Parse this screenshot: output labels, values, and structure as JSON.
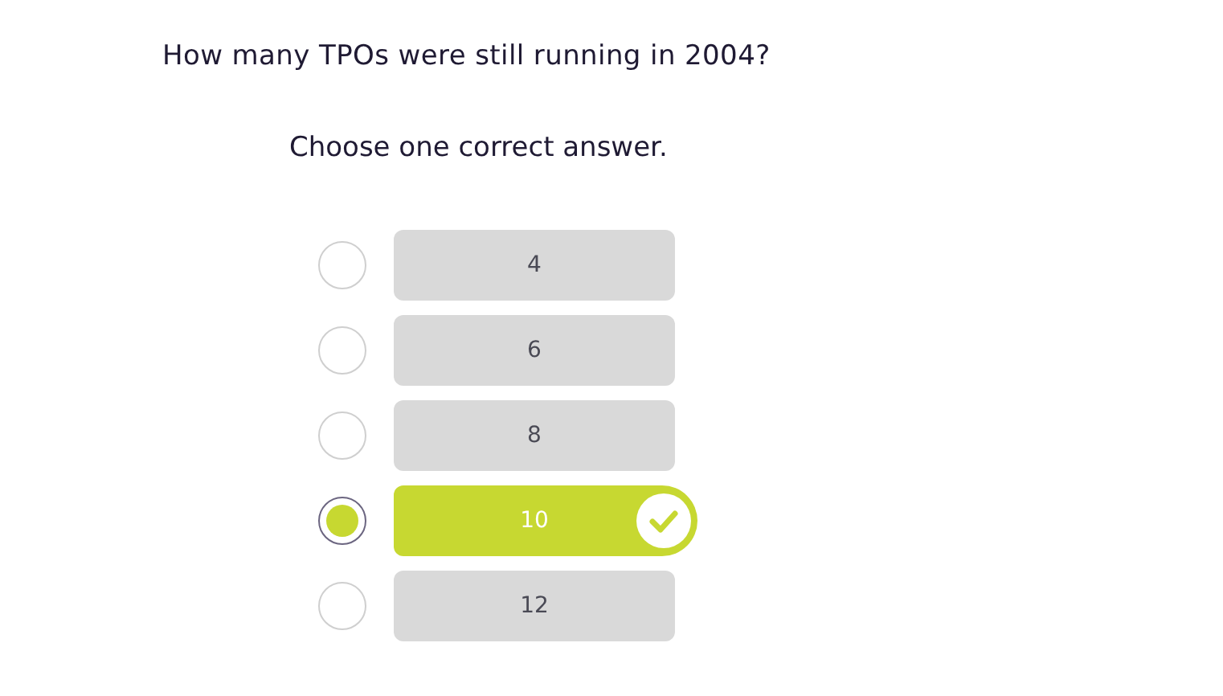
{
  "question": "How many TPOs were still running in 2004?",
  "instruction": "Choose one correct answer.",
  "options": [
    {
      "label": "4",
      "selected": false,
      "correct": false
    },
    {
      "label": "6",
      "selected": false,
      "correct": false
    },
    {
      "label": "8",
      "selected": false,
      "correct": false
    },
    {
      "label": "10",
      "selected": true,
      "correct": true
    },
    {
      "label": "12",
      "selected": false,
      "correct": false
    }
  ]
}
